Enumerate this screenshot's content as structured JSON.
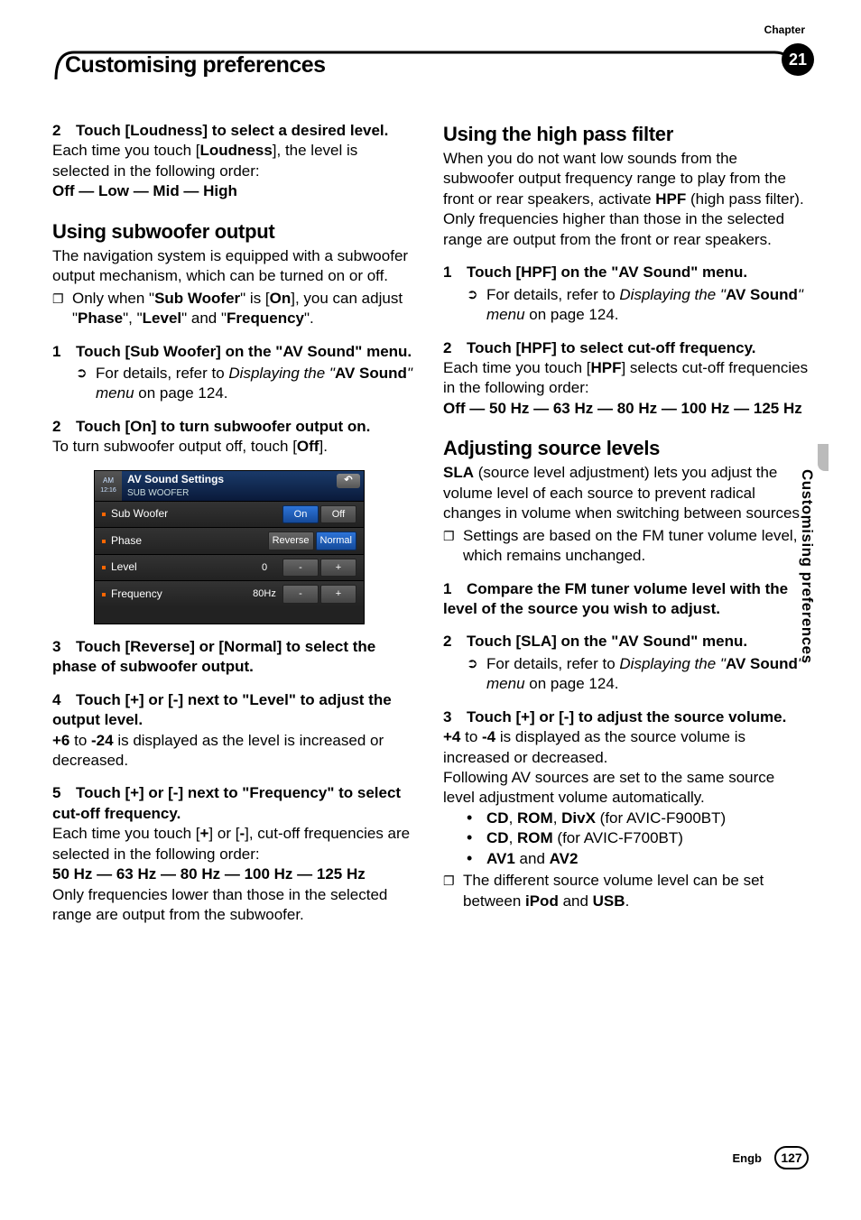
{
  "header": {
    "chapter_label": "Chapter",
    "title": "Customising preferences",
    "chapter_number": "21"
  },
  "side_tab": "Customising preferences",
  "footer": {
    "lang": "Engb",
    "page": "127"
  },
  "left": {
    "step2": {
      "num": "2",
      "title": "Touch [Loudness] to select a desired level.",
      "p1_a": "Each time you touch [",
      "p1_b": "Loudness",
      "p1_c": "], the level is selected in the following order:",
      "seq": "Off — Low — Mid — High"
    },
    "sub_h": "Using subwoofer output",
    "sub_intro": "The navigation system is equipped with a subwoofer output mechanism, which can be turned on or off.",
    "sub_note_a": "Only when \"",
    "sub_note_b": "Sub Woofer",
    "sub_note_c": "\" is [",
    "sub_note_d": "On",
    "sub_note_e": "], you can adjust \"",
    "sub_note_f": "Phase",
    "sub_note_g": "\", \"",
    "sub_note_h": "Level",
    "sub_note_i": "\" and \"",
    "sub_note_j": "Frequency",
    "sub_note_k": "\".",
    "s1": {
      "num": "1",
      "title": "Touch [Sub Woofer] on the \"AV Sound\" menu.",
      "ref_a": "For details, refer to ",
      "ref_b": "Displaying the \"",
      "ref_c": "AV Sound",
      "ref_d": "\" menu",
      "ref_e": " on page 124."
    },
    "s2": {
      "num": "2",
      "title": "Touch [On] to turn subwoofer output on.",
      "p_a": "To turn subwoofer output off, touch [",
      "p_b": "Off",
      "p_c": "]."
    },
    "s3": {
      "num": "3",
      "title": "Touch [Reverse] or [Normal] to select the phase of subwoofer output."
    },
    "s4": {
      "num": "4",
      "title": "Touch [+] or [-] next to \"Level\" to adjust the output level.",
      "p_a": "+6",
      "p_b": " to ",
      "p_c": "-24",
      "p_d": " is displayed as the level is increased or decreased."
    },
    "s5": {
      "num": "5",
      "title": "Touch [+] or [-] next to \"Frequency\" to select cut-off frequency.",
      "p_a": "Each time you touch [",
      "p_b": "+",
      "p_c": "] or [",
      "p_d": "-",
      "p_e": "], cut-off frequencies are selected in the following order:",
      "seq": "50 Hz — 63 Hz — 80 Hz — 100 Hz — 125 Hz",
      "after": "Only frequencies lower than those in the selected range are output from the subwoofer."
    },
    "device": {
      "src_top": "AM",
      "src_bot": "12:16",
      "title": "AV Sound Settings",
      "subtitle": "SUB WOOFER",
      "row1": {
        "label": "Sub Woofer",
        "on": "On",
        "off": "Off"
      },
      "row2": {
        "label": "Phase",
        "rev": "Reverse",
        "norm": "Normal"
      },
      "row3": {
        "label": "Level",
        "val": "0",
        "minus": "-",
        "plus": "+"
      },
      "row4": {
        "label": "Frequency",
        "val": "80Hz",
        "minus": "-",
        "plus": "+"
      }
    }
  },
  "right": {
    "hpf_h": "Using the high pass filter",
    "hpf_intro_a": "When you do not want low sounds from the subwoofer output frequency range to play from the front or rear speakers, activate ",
    "hpf_intro_b": "HPF",
    "hpf_intro_c": " (high pass filter). Only frequencies higher than those in the selected range are output from the front or rear speakers.",
    "h1": {
      "num": "1",
      "title": "Touch [HPF] on the \"AV Sound\" menu.",
      "ref_a": "For details, refer to ",
      "ref_b": "Displaying the \"",
      "ref_c": "AV Sound",
      "ref_d": "\" menu",
      "ref_e": " on page 124."
    },
    "h2": {
      "num": "2",
      "title": "Touch [HPF] to select cut-off frequency.",
      "p_a": "Each time you touch [",
      "p_b": "HPF",
      "p_c": "] selects cut-off frequencies in the following order:",
      "seq": "Off — 50 Hz — 63 Hz — 80 Hz — 100 Hz — 125 Hz"
    },
    "sla_h": "Adjusting source levels",
    "sla_intro_a": "SLA",
    "sla_intro_b": " (source level adjustment) lets you adjust the volume level of each source to prevent radical changes in volume when switching between sources.",
    "sla_note": "Settings are based on the FM tuner volume level, which remains unchanged.",
    "a1": {
      "num": "1",
      "title": "Compare the FM tuner volume level with the level of the source you wish to adjust."
    },
    "a2": {
      "num": "2",
      "title": "Touch [SLA] on the \"AV Sound\" menu.",
      "ref_a": "For details, refer to ",
      "ref_b": "Displaying the \"",
      "ref_c": "AV Sound",
      "ref_d": "\" menu",
      "ref_e": " on page 124."
    },
    "a3": {
      "num": "3",
      "title": "Touch [+] or [-] to adjust the source volume.",
      "p_a": "+4",
      "p_b": " to ",
      "p_c": "-4",
      "p_d": " is displayed as the source volume is increased or decreased.",
      "after": "Following AV sources are set to the same source level adjustment volume automatically.",
      "b1_a": "CD",
      "b1_b": ", ",
      "b1_c": "ROM",
      "b1_d": ", ",
      "b1_e": "DivX",
      "b1_f": " (for AVIC-F900BT)",
      "b2_a": "CD",
      "b2_b": ", ",
      "b2_c": "ROM",
      "b2_d": " (for AVIC-F700BT)",
      "b3_a": "AV1",
      "b3_b": " and ",
      "b3_c": "AV2",
      "note_a": "The different source volume level can be set between ",
      "note_b": "iPod",
      "note_c": " and ",
      "note_d": "USB",
      "note_e": "."
    }
  }
}
